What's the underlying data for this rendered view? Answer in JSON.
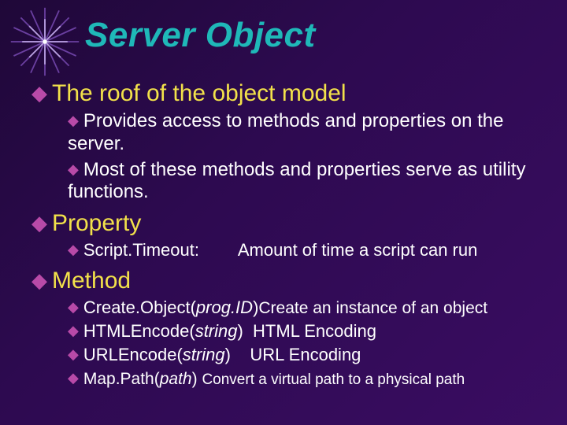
{
  "title": "Server Object",
  "bullets": {
    "root": {
      "label": "The roof of the object model",
      "sub1": "Provides access to methods and properties on the server.",
      "sub2": "Most of these methods and properties serve as utility functions."
    },
    "property": {
      "label": "Property",
      "script_timeout": {
        "name": "Script.Timeout:",
        "desc": "Amount of time a script can run"
      }
    },
    "method": {
      "label": "Method",
      "create_object": {
        "name": "Create.Object(",
        "arg": "prog.ID",
        "close": ")",
        "desc": "Create an instance of an object"
      },
      "html_encode": {
        "name": "HTMLEncode(",
        "arg": "string",
        "close": ")",
        "desc": "HTML Encoding"
      },
      "url_encode": {
        "name": "URLEncode(",
        "arg": "string",
        "close": ")",
        "desc": "URL Encoding"
      },
      "map_path": {
        "name": "Map.Path(",
        "arg": "path",
        "close": ")",
        "desc": "Convert a virtual path to a physical path"
      }
    }
  }
}
